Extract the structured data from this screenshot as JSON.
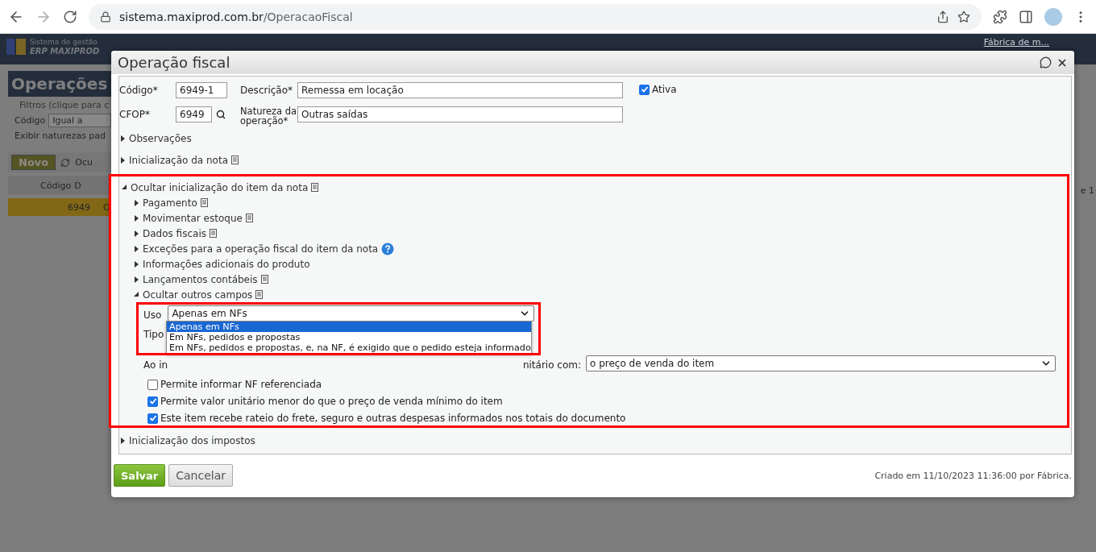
{
  "browser": {
    "url_host": "sistema.maxiprod.com.br",
    "url_path": "/OperacaoFiscal"
  },
  "app": {
    "logo_line1": "Sistema de gestão",
    "logo_line2": "ERP MAXIPROD",
    "user": "Fábrica de m...",
    "page_title": "Operações",
    "filters_legend": "Filtros (clique para c",
    "filter_label": "Código",
    "filter_value": "Igual a",
    "show_label": "Exibir naturezas pad",
    "new_button": "Novo",
    "toolbar_text": "Ocu",
    "columns": [
      "Código",
      "D"
    ],
    "row": {
      "selected": true,
      "cells": [
        "6949",
        "O"
      ]
    },
    "pager": "e 1"
  },
  "dialog": {
    "title": "Operação fiscal",
    "fields": {
      "code": {
        "label": "Código*",
        "value": "6949-1"
      },
      "description": {
        "label": "Descrição*",
        "value": "Remessa em locação"
      },
      "cfop": {
        "label": "CFOP*",
        "value": "6949"
      },
      "nature": {
        "label": "Natureza da operação*",
        "value": "Outras saídas"
      },
      "active": {
        "label": "Ativa",
        "checked": true
      }
    },
    "sections_before": [
      {
        "label": "Observações",
        "expanded": false
      },
      {
        "label": "Inicialização da nota",
        "expanded": false,
        "kind": "note"
      }
    ],
    "item_section": {
      "label": "Ocultar inicialização do item da nota",
      "expanded": true,
      "kind": "note",
      "children": [
        {
          "label": "Pagamento",
          "expanded": false,
          "kind": "note"
        },
        {
          "label": "Movimentar estoque",
          "expanded": false,
          "kind": "note"
        },
        {
          "label": "Dados fiscais",
          "expanded": false,
          "kind": "note"
        },
        {
          "label": "Exceções para a operação fiscal do item da nota",
          "expanded": false,
          "kind": "help"
        },
        {
          "label": "Informações adicionais do produto",
          "expanded": false
        },
        {
          "label": "Lançamentos contábeis",
          "expanded": false,
          "kind": "note"
        },
        {
          "label": "Ocultar outros campos",
          "expanded": true,
          "kind": "note",
          "content": {
            "usage": {
              "label": "Uso",
              "value": "Apenas em NFs",
              "open": true,
              "options": [
                {
                  "label": "Apenas em NFs",
                  "selected": true
                },
                {
                  "label": "Em NFs, pedidos e propostas",
                  "selected": false
                },
                {
                  "label": "Em NFs, pedidos e propostas, e, na NF, é exigido que o pedido esteja informado",
                  "selected": false
                }
              ]
            },
            "type_label": "Tipo",
            "price_label_start": "Ao in",
            "price_label_end": "nitário com:",
            "price_value": "o preço de venda do item",
            "checks": [
              {
                "label": "Permite informar NF referenciada",
                "checked": false
              },
              {
                "label": "Permite valor unitário menor do que o preço de venda mínimo do item",
                "checked": true
              },
              {
                "label": "Este item recebe rateio do frete, seguro e outras despesas informados nos totais do documento",
                "checked": true
              }
            ]
          }
        }
      ]
    },
    "sections_after": [
      {
        "label": "Inicialização dos impostos",
        "expanded": false
      }
    ],
    "buttons": [
      {
        "label": "Salvar",
        "kind": "primary"
      },
      {
        "label": "Cancelar",
        "kind": "secondary"
      }
    ],
    "created": "Criado em 11/10/2023 11:36:00 por Fábrica."
  }
}
